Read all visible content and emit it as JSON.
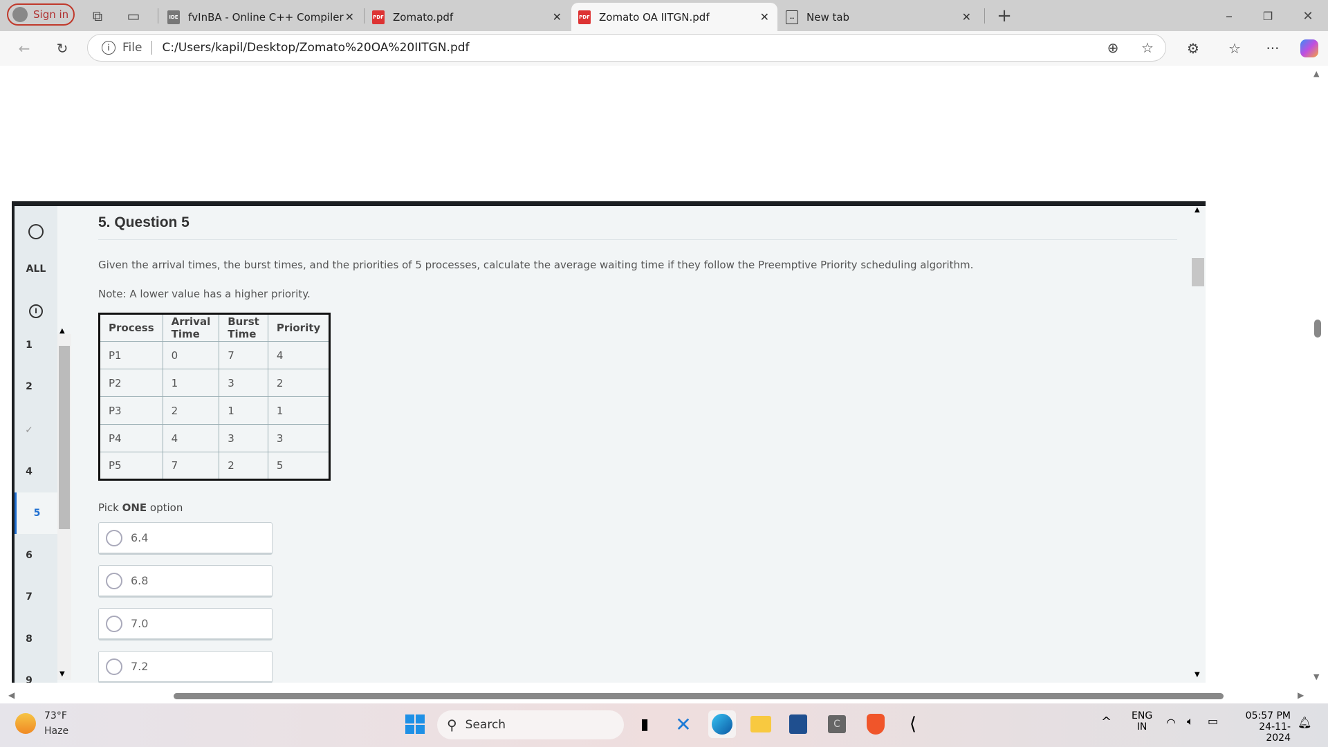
{
  "browser": {
    "sign_in": "Sign in",
    "tabs": [
      {
        "label": "fvInBA - Online C++ Compiler & I",
        "icon": "ideone-icon"
      },
      {
        "label": "Zomato.pdf",
        "icon": "pdf-icon"
      },
      {
        "label": "Zomato OA IITGN.pdf",
        "icon": "pdf-icon",
        "active": true
      },
      {
        "label": "New tab",
        "icon": "newtab-icon"
      }
    ],
    "address_prefix": "File",
    "url": "C:/Users/kapil/Desktop/Zomato%20OA%20IITGN.pdf"
  },
  "sidebar": {
    "all": "ALL",
    "items": [
      "1",
      "2",
      "✓",
      "4",
      "5",
      "6",
      "7",
      "8",
      "9"
    ],
    "active": "5"
  },
  "question": {
    "title": "5. Question 5",
    "description": "Given the arrival times, the burst times, and the priorities of 5 processes, calculate the average waiting time if they follow the Preemptive Priority scheduling algorithm.",
    "note": "Note: A lower value has a higher priority.",
    "table": {
      "headers": [
        "Process",
        "Arrival Time",
        "Burst Time",
        "Priority"
      ],
      "rows": [
        [
          "P1",
          "0",
          "7",
          "4"
        ],
        [
          "P2",
          "1",
          "3",
          "2"
        ],
        [
          "P3",
          "2",
          "1",
          "1"
        ],
        [
          "P4",
          "4",
          "3",
          "3"
        ],
        [
          "P5",
          "7",
          "2",
          "5"
        ]
      ]
    },
    "pick_prefix": "Pick ",
    "pick_bold": "ONE",
    "pick_suffix": " option",
    "options": [
      "6.4",
      "6.8",
      "7.0",
      "7.2"
    ]
  },
  "taskbar": {
    "weather_temp": "73°F",
    "weather_desc": "Haze",
    "search": "Search",
    "lang1": "ENG",
    "lang2": "IN",
    "time": "05:57 PM",
    "date": "24-11-2024"
  },
  "colors": {
    "accent": "#1f6fd1",
    "page_bg": "#f2f5f6"
  }
}
